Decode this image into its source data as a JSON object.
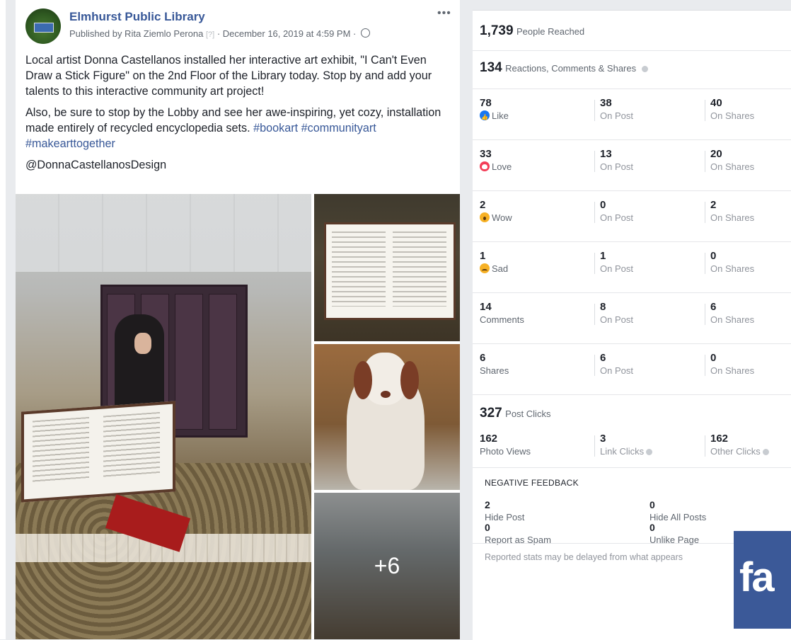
{
  "post": {
    "page_name": "Elmhurst Public Library",
    "published_by": "Published by Rita Ziemlo Perona",
    "help_marker": "[?]",
    "date": "· December 16, 2019 at 4:59 PM ·",
    "more_label": "•••",
    "paragraph1": "Local artist Donna Castellanos installed her interactive art exhibit, \"I Can't Even Draw a Stick Figure\" on the 2nd Floor of the Library today. Stop by and add your talents to this interactive community art project!",
    "paragraph2_text": "Also, be sure to stop by the Lobby and see her awe-inspiring, yet cozy, installation made entirely of recycled encyclopedia sets.",
    "hashtags": [
      "#bookart",
      "#communityart",
      "#makearttogether"
    ],
    "mention": "@DonnaCastellanosDesign",
    "more_photos": "+6"
  },
  "stats": {
    "people_reached": {
      "value": "1,739",
      "label": "People Reached"
    },
    "engagement": {
      "value": "134",
      "label": "Reactions, Comments & Shares"
    },
    "breakdown": [
      {
        "total": "78",
        "label": "Like",
        "icon": "like-icon",
        "on_post": "38",
        "on_shares": "40"
      },
      {
        "total": "33",
        "label": "Love",
        "icon": "love-icon",
        "on_post": "13",
        "on_shares": "20"
      },
      {
        "total": "2",
        "label": "Wow",
        "icon": "wow-icon",
        "on_post": "0",
        "on_shares": "2"
      },
      {
        "total": "1",
        "label": "Sad",
        "icon": "sad-icon",
        "on_post": "1",
        "on_shares": "0"
      },
      {
        "total": "14",
        "label": "Comments",
        "icon": "",
        "on_post": "8",
        "on_shares": "6"
      },
      {
        "total": "6",
        "label": "Shares",
        "icon": "",
        "on_post": "6",
        "on_shares": "0"
      }
    ],
    "on_post_label": "On Post",
    "on_shares_label": "On Shares",
    "post_clicks": {
      "value": "327",
      "label": "Post Clicks"
    },
    "clicks": [
      {
        "value": "162",
        "label": "Photo Views"
      },
      {
        "value": "3",
        "label": "Link Clicks"
      },
      {
        "value": "162",
        "label": "Other Clicks"
      }
    ],
    "negative_title": "NEGATIVE FEEDBACK",
    "negative": [
      {
        "value": "2",
        "label": "Hide Post"
      },
      {
        "value": "0",
        "label": "Hide All Posts"
      },
      {
        "value": "0",
        "label": "Report as Spam"
      },
      {
        "value": "0",
        "label": "Unlike Page"
      }
    ],
    "footnote": "Reported stats may be delayed from what appears"
  },
  "logo": {
    "text": "fa"
  },
  "colors": {
    "brand": "#385898",
    "facebook_blue": "#3b5998",
    "background": "#e9ebee"
  }
}
